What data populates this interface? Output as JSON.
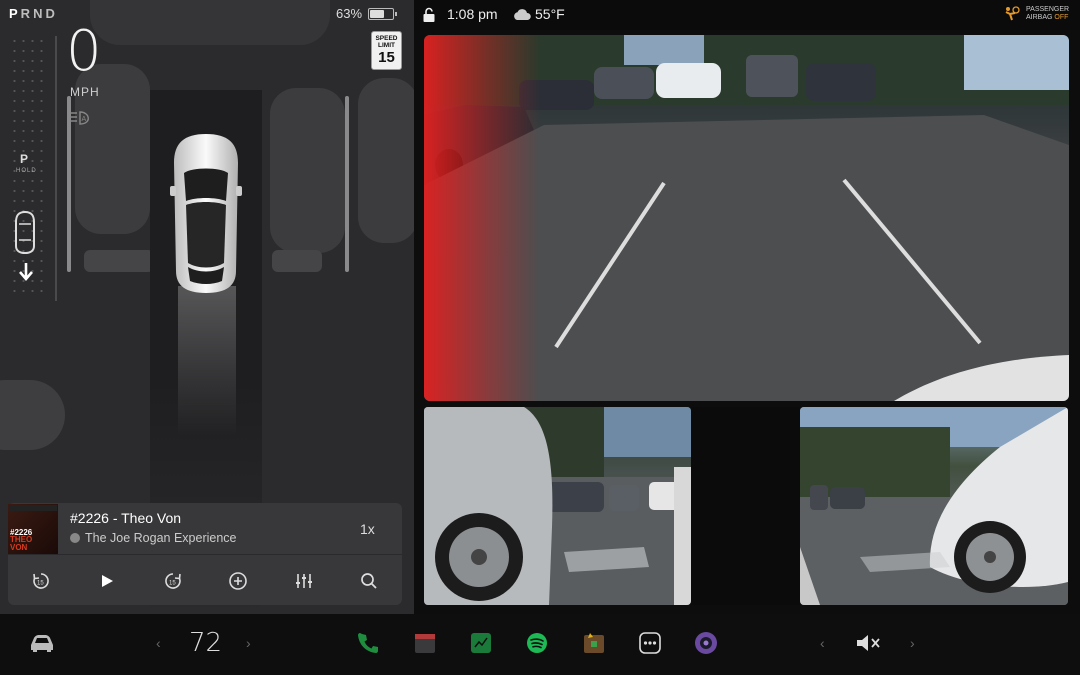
{
  "status": {
    "gears": [
      "P",
      "R",
      "N",
      "D"
    ],
    "active_gear": "P",
    "battery_percent": "63%",
    "battery_level": 0.63
  },
  "drive": {
    "speed": "0",
    "speed_unit": "MPH",
    "speed_limit_label_1": "SPEED",
    "speed_limit_label_2": "LIMIT",
    "speed_limit": "15",
    "gear_indicator": "P",
    "hold_label": "HOLD"
  },
  "media": {
    "episode_title": "#2226 - Theo Von",
    "podcast_name": "The Joe Rogan Experience",
    "playback_rate": "1x",
    "art_text_line1": "#2226",
    "art_text_line2": "THEO",
    "art_text_line3": "VON",
    "controls": [
      "rewind-15-icon",
      "play-icon",
      "forward-15-icon",
      "add-icon",
      "equalizer-icon",
      "search-icon"
    ]
  },
  "topbar": {
    "time": "1:08 pm",
    "temperature": "55°F",
    "airbag_label_1": "PASSENGER",
    "airbag_label_2": "AIRBAG",
    "airbag_status": "OFF"
  },
  "dock": {
    "cabin_temperature": "72",
    "icons": [
      "car-icon",
      "phone-icon",
      "calendar-icon",
      "messages-icon",
      "spotify-icon",
      "toybox-icon",
      "more-icon",
      "camera-icon",
      "volume-muted-icon"
    ]
  },
  "colors": {
    "accent_green": "#1db954",
    "airbag_off": "#e69a2b",
    "proximity_red": "#e02020"
  }
}
